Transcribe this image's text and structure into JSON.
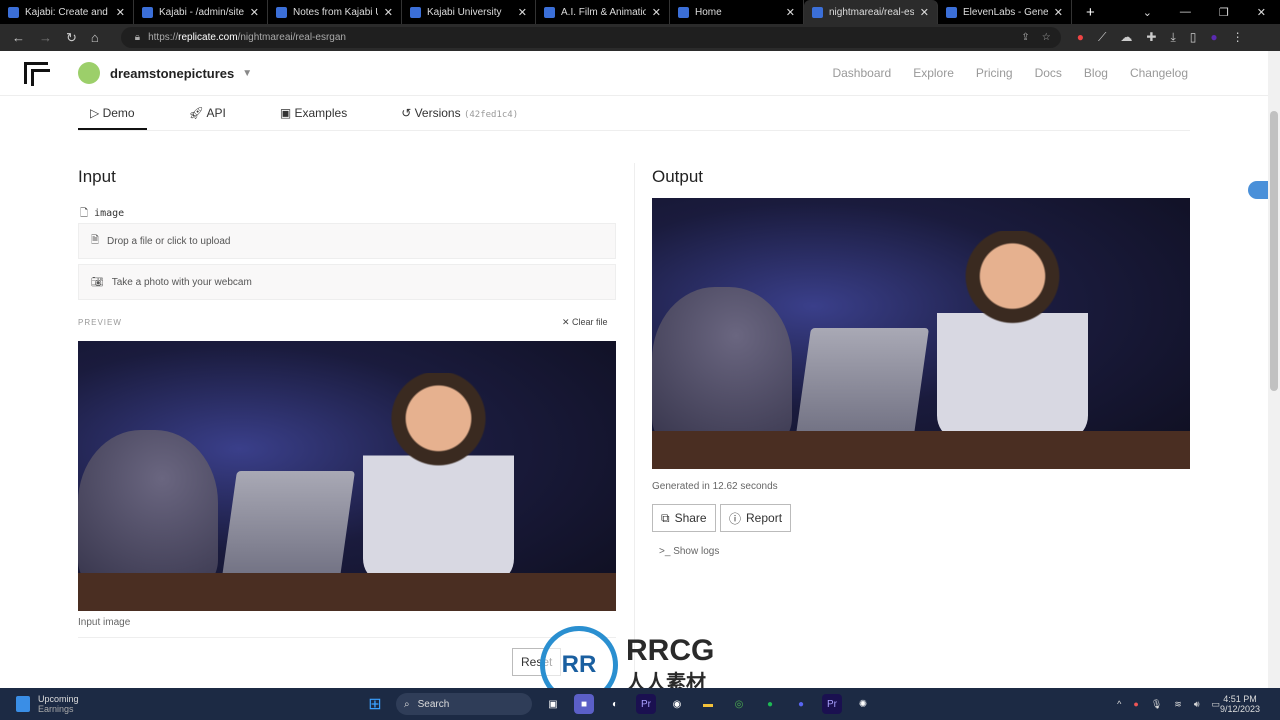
{
  "browser": {
    "tabs": [
      {
        "title": "Kajabi: Create and sell",
        "active": false
      },
      {
        "title": "Kajabi - /admin/sites/",
        "active": false
      },
      {
        "title": "Notes from Kajabi Uni",
        "active": false
      },
      {
        "title": "Kajabi University",
        "active": false
      },
      {
        "title": "A.I. Film & Animation",
        "active": false
      },
      {
        "title": "Home",
        "active": false
      },
      {
        "title": "nightmareai/real-esrgan",
        "active": true
      },
      {
        "title": "ElevenLabs - Generat",
        "active": false
      }
    ],
    "new_tab": "+",
    "url_scheme": "https://",
    "url_host": "replicate.com",
    "url_path": "/nightmareai/real-esrgan"
  },
  "header": {
    "username": "dreamstonepictures",
    "menu": [
      "Dashboard",
      "Explore",
      "Pricing",
      "Docs",
      "Blog",
      "Changelog"
    ]
  },
  "model_tabs": {
    "demo": "Demo",
    "api": "API",
    "examples": "Examples",
    "versions": "Versions",
    "version_id": "(42fed1c4)"
  },
  "input": {
    "title": "Input",
    "field": "image",
    "upload": "Drop a file or click to upload",
    "webcam": "Take a photo with your webcam",
    "preview": "PREVIEW",
    "clear": "Clear file",
    "caption": "Input image",
    "reset": "Reset"
  },
  "output": {
    "title": "Output",
    "generated": "Generated in 12.62 seconds",
    "share": "Share",
    "report": "Report",
    "logs": "Show logs"
  },
  "taskbar": {
    "widget_title": "Upcoming",
    "widget_sub": "Earnings",
    "search": "Search",
    "time": "4:51 PM",
    "date": "9/12/2023"
  },
  "watermark": {
    "text": "RRCG",
    "sub": "人人素材"
  },
  "colors": {
    "accent": "#111111",
    "taskbar": "#1c2a44"
  }
}
